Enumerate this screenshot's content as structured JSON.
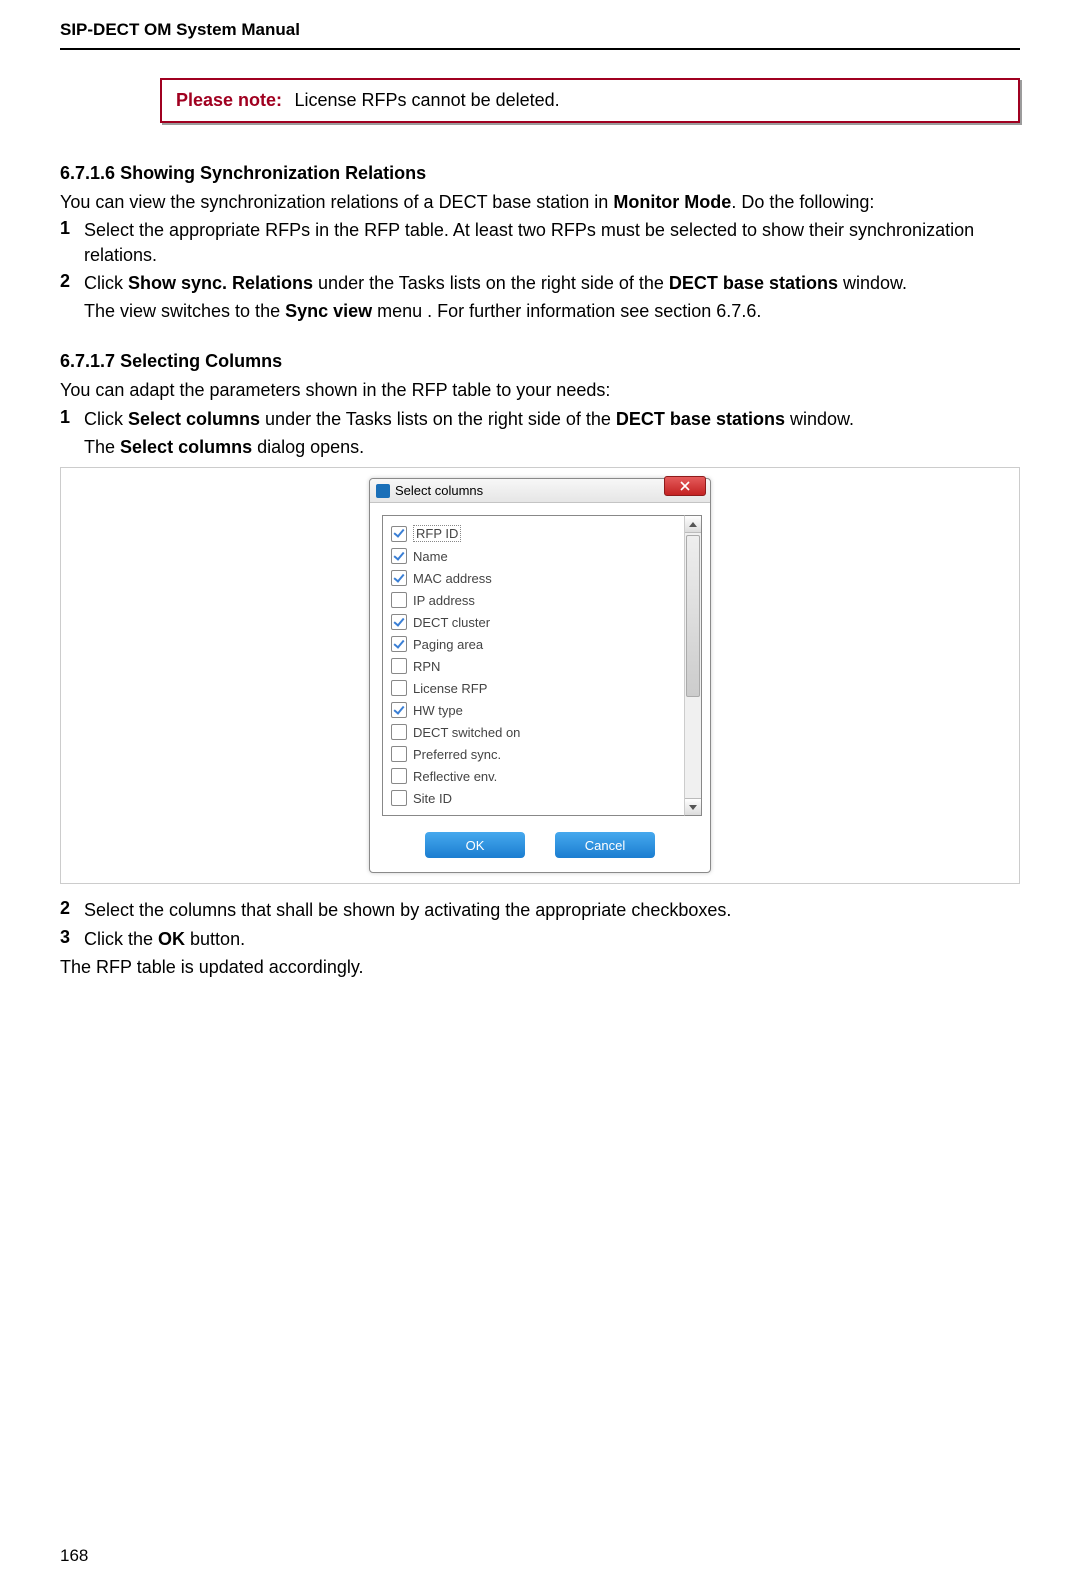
{
  "header": {
    "doc_title": "SIP-DECT OM System Manual"
  },
  "note": {
    "label": "Please note:",
    "text": "License RFPs cannot be deleted."
  },
  "section1": {
    "num": "6.7.1.6",
    "title": "Showing Synchronization Relations",
    "intro_pre": "You can view the synchronization relations of a DECT base station in ",
    "intro_bold": "Monitor Mode",
    "intro_post": ". Do the following:",
    "step1": "Select the appropriate RFPs in the RFP table. At least two RFPs must be selected to show their synchronization relations.",
    "step2_pre": "Click ",
    "step2_b1": "Show sync. Relations",
    "step2_mid": " under the Tasks lists on the right side of the ",
    "step2_b2": "DECT base stations",
    "step2_post": " window.",
    "step2_cont_pre": "The view switches to the ",
    "step2_cont_b": "Sync view",
    "step2_cont_post": " menu . For further information see section 6.7.6."
  },
  "section2": {
    "num": "6.7.1.7",
    "title": "Selecting Columns",
    "intro": "You can adapt the parameters shown in the RFP table to your needs:",
    "step1_pre": "Click ",
    "step1_b1": "Select columns",
    "step1_mid": " under the Tasks lists on the right side of the ",
    "step1_b2": "DECT base stations",
    "step1_post": " window.",
    "step1_cont_pre": "The ",
    "step1_cont_b": "Select columns",
    "step1_cont_post": " dialog opens.",
    "step2": "Select the columns that shall be shown by activating the appropriate checkboxes.",
    "step3_pre": "Click the ",
    "step3_b": "OK",
    "step3_post": " button.",
    "closing": "The RFP table is updated accordingly."
  },
  "dialog": {
    "title": "Select columns",
    "items": [
      {
        "label": "RFP ID",
        "checked": true,
        "selected": true
      },
      {
        "label": "Name",
        "checked": true,
        "selected": false
      },
      {
        "label": "MAC address",
        "checked": true,
        "selected": false
      },
      {
        "label": "IP address",
        "checked": false,
        "selected": false
      },
      {
        "label": "DECT cluster",
        "checked": true,
        "selected": false
      },
      {
        "label": "Paging area",
        "checked": true,
        "selected": false
      },
      {
        "label": "RPN",
        "checked": false,
        "selected": false
      },
      {
        "label": "License RFP",
        "checked": false,
        "selected": false
      },
      {
        "label": "HW type",
        "checked": true,
        "selected": false
      },
      {
        "label": "DECT switched on",
        "checked": false,
        "selected": false
      },
      {
        "label": "Preferred sync.",
        "checked": false,
        "selected": false
      },
      {
        "label": "Reflective env.",
        "checked": false,
        "selected": false
      },
      {
        "label": "Site ID",
        "checked": false,
        "selected": false
      }
    ],
    "ok": "OK",
    "cancel": "Cancel"
  },
  "page_number": "168"
}
